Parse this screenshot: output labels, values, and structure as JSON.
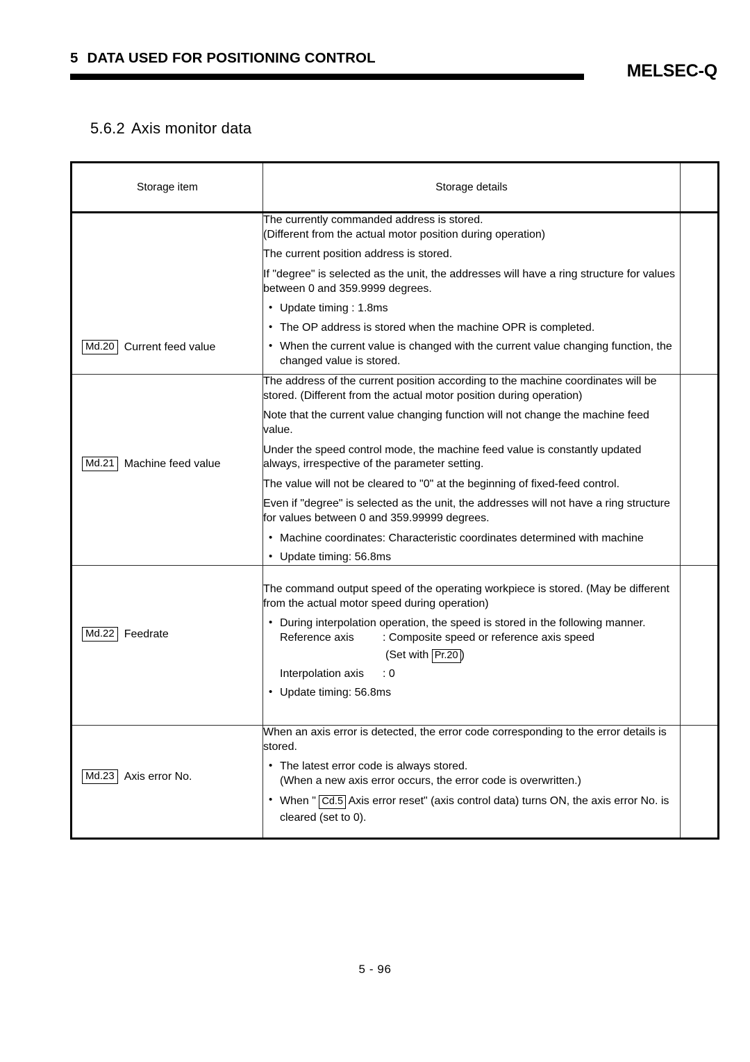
{
  "header": {
    "chapter_number": "5",
    "chapter_title": "DATA USED FOR POSITIONING CONTROL",
    "brand": "MELSEC-Q"
  },
  "section": {
    "number": "5.6.2",
    "title": "Axis monitor data"
  },
  "table": {
    "columns": [
      "Storage item",
      "Storage details",
      ""
    ],
    "rows": [
      {
        "ref_tag": "Md.20",
        "item_name": "Current feed value",
        "paragraphs": [
          "The currently commanded address is stored.\n(Different from the actual motor position during operation)",
          "The current position address is stored.",
          "If \"degree\" is selected as the unit, the addresses will have a ring structure for values between 0 and 359.9999 degrees."
        ],
        "bullets": [
          "Update timing : 1.8ms",
          "The OP address is stored when the machine OPR is completed.",
          "When the current value is changed with the current value changing function, the changed value is stored."
        ]
      },
      {
        "ref_tag": "Md.21",
        "item_name": "Machine feed value",
        "paragraphs": [
          "The address of the current position according to the machine coordinates will be stored. (Different from the actual motor position during operation)",
          "Note that the current value changing function will not change the machine feed value.",
          "Under the speed control mode, the machine feed value is constantly updated always, irrespective of the parameter setting.",
          "The value will not be cleared to \"0\" at the beginning of fixed-feed control.",
          "Even if \"degree\" is selected as the unit, the addresses will not have a ring structure for values between 0 and 359.99999 degrees."
        ],
        "bullets": [
          "Machine coordinates: Characteristic coordinates determined with machine",
          "Update timing: 56.8ms"
        ]
      },
      {
        "ref_tag": "Md.22",
        "item_name": "Feedrate",
        "paragraphs": [
          "The command output speed of the operating workpiece is stored. (May be different from the actual motor speed during operation)"
        ],
        "interpolation": {
          "bullet_text": "During interpolation operation, the speed is stored in the following manner.",
          "reference_axis_label": "Reference axis",
          "reference_axis_value": ": Composite speed or reference axis speed",
          "set_with_prefix": "(Set with",
          "set_with_ref": "Pr.20",
          "set_with_suffix": ")",
          "interpolation_axis_label": "Interpolation axis",
          "interpolation_axis_value": ": 0",
          "update_timing": "Update timing: 56.8ms"
        }
      },
      {
        "ref_tag": "Md.23",
        "item_name": "Axis error No.",
        "paragraphs": [
          "When an axis error is detected, the error code corresponding to the error details is stored."
        ],
        "bullets": [
          "The latest error code is always stored.\n(When a new axis error occurs, the error code is overwritten.)"
        ],
        "reset_bullet": {
          "prefix": "When \"",
          "ref": "Cd.5",
          "suffix": "Axis error reset\" (axis control data) turns ON, the axis error No. is cleared (set to 0)."
        }
      }
    ]
  },
  "footer": {
    "page_number": "5 -  96"
  }
}
